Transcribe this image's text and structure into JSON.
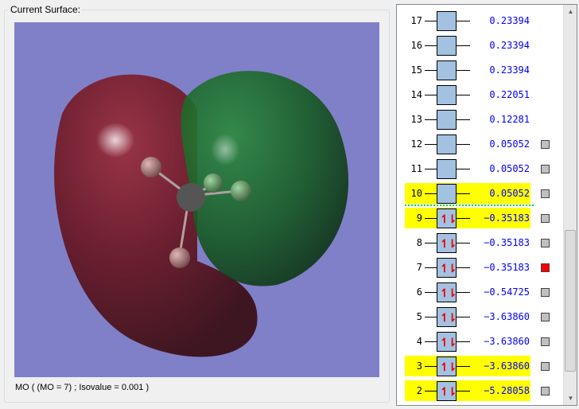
{
  "surface_group": {
    "title": "Current Surface:",
    "caption": "MO ( (MO = 7) ; Isovalue = 0.001 )",
    "viewport_bg": "#8080c8"
  },
  "orbitals": [
    {
      "n": "17",
      "energy": "0.23394",
      "occupied": false,
      "highlight": false,
      "checkbox": null
    },
    {
      "n": "16",
      "energy": "0.23394",
      "occupied": false,
      "highlight": false,
      "checkbox": null
    },
    {
      "n": "15",
      "energy": "0.23394",
      "occupied": false,
      "highlight": false,
      "checkbox": null
    },
    {
      "n": "14",
      "energy": "0.22051",
      "occupied": false,
      "highlight": false,
      "checkbox": null
    },
    {
      "n": "13",
      "energy": "0.12281",
      "occupied": false,
      "highlight": false,
      "checkbox": null
    },
    {
      "n": "12",
      "energy": "0.05052",
      "occupied": false,
      "highlight": false,
      "checkbox": "off"
    },
    {
      "n": "11",
      "energy": "0.05052",
      "occupied": false,
      "highlight": false,
      "checkbox": "off"
    },
    {
      "n": "10",
      "energy": "0.05052",
      "occupied": false,
      "highlight": true,
      "checkbox": "off",
      "lumo": true
    },
    {
      "n": "9",
      "energy": "−0.35183",
      "occupied": true,
      "highlight": true,
      "checkbox": "off"
    },
    {
      "n": "8",
      "energy": "−0.35183",
      "occupied": true,
      "highlight": false,
      "checkbox": "off"
    },
    {
      "n": "7",
      "energy": "−0.35183",
      "occupied": true,
      "highlight": false,
      "checkbox": "on"
    },
    {
      "n": "6",
      "energy": "−0.54725",
      "occupied": true,
      "highlight": false,
      "checkbox": "off"
    },
    {
      "n": "5",
      "energy": "−3.63860",
      "occupied": true,
      "highlight": false,
      "checkbox": "off"
    },
    {
      "n": "4",
      "energy": "−3.63860",
      "occupied": true,
      "highlight": false,
      "checkbox": "off"
    },
    {
      "n": "3",
      "energy": "−3.63860",
      "occupied": true,
      "highlight": true,
      "checkbox": "off"
    },
    {
      "n": "2",
      "energy": "−5.28058",
      "occupied": true,
      "highlight": true,
      "checkbox": "off"
    }
  ],
  "electron_glyph": "↿⇂",
  "scrollbar": {
    "up": "▲",
    "down": "▼",
    "position": 0.62
  }
}
